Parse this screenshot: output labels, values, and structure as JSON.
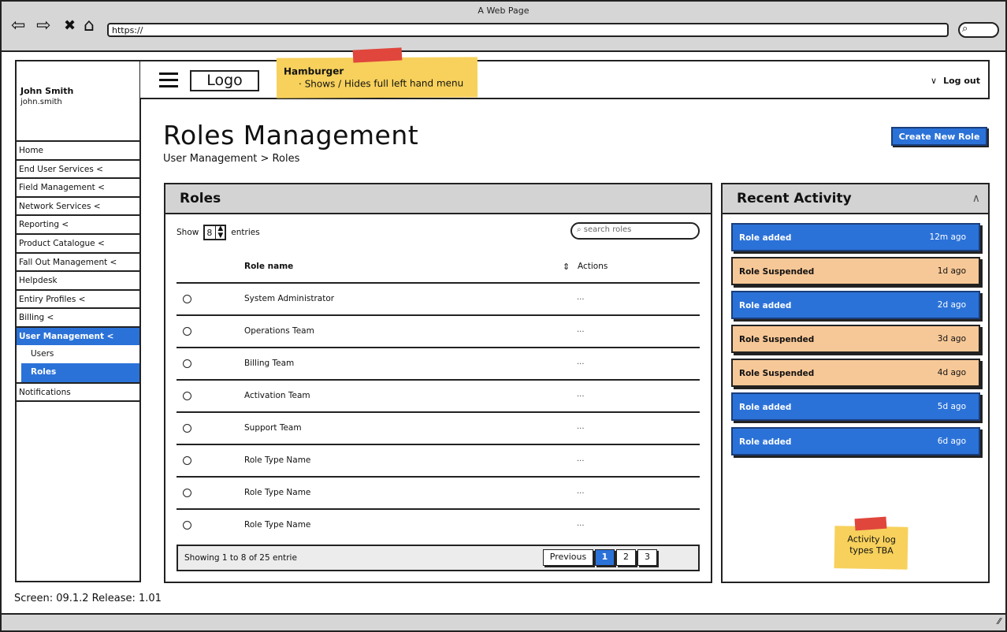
{
  "browser": {
    "window_title": "A Web Page",
    "url": "https://",
    "nav_icons": {
      "back": "⇦",
      "forward": "⇨",
      "close": "✖",
      "home": "⌂"
    },
    "search_icon": "⌕"
  },
  "sidebar": {
    "user_name": "John Smith",
    "user_login": "john.smith",
    "items": [
      {
        "label": "Home"
      },
      {
        "label": "End User Services <"
      },
      {
        "label": "Field Management <"
      },
      {
        "label": "Network Services <"
      },
      {
        "label": "Reporting <"
      },
      {
        "label": "Product Catalogue <"
      },
      {
        "label": "Fall Out Management <"
      },
      {
        "label": "Helpdesk"
      },
      {
        "label": "Entiry Profiles <"
      },
      {
        "label": "Billing <"
      },
      {
        "label": "User Management <"
      }
    ],
    "sub_items": [
      {
        "label": "Users"
      },
      {
        "label": "Roles"
      }
    ],
    "after_items": [
      {
        "label": "Notifications"
      }
    ]
  },
  "header": {
    "logo": "Logo",
    "logout": "Log out",
    "logout_chevron": "∨"
  },
  "notes": {
    "hamburger_title": "Hamburger",
    "hamburger_text": "·   Shows / Hides full left hand menu",
    "activity_note": "Activity log types TBA"
  },
  "page": {
    "title": "Roles Management",
    "breadcrumb": "User Management > Roles",
    "create_button": "Create New Role"
  },
  "roles": {
    "panel_title": "Roles",
    "show_label": "Show",
    "entries_value": "8",
    "entries_label": "entries",
    "search_placeholder": "search roles",
    "col_name": "Role name",
    "col_actions": "Actions",
    "sort_icon": "⇕",
    "rows": [
      {
        "name": "System Administrator",
        "action": "..."
      },
      {
        "name": "Operations Team",
        "action": "..."
      },
      {
        "name": "Billing Team",
        "action": "..."
      },
      {
        "name": "Activation Team",
        "action": "..."
      },
      {
        "name": "Support Team",
        "action": "..."
      },
      {
        "name": "Role Type Name",
        "action": "..."
      },
      {
        "name": "Role Type Name",
        "action": "..."
      },
      {
        "name": "Role Type Name",
        "action": "..."
      }
    ],
    "footer_info": "Showing 1 to 8 of 25 entrie",
    "pager": {
      "previous": "Previous",
      "pages": [
        "1",
        "2",
        "3"
      ],
      "active_page": "1"
    }
  },
  "activity": {
    "panel_title": "Recent Activity",
    "collapse_icon": "∧",
    "items": [
      {
        "label": "Role added",
        "time": "12m ago",
        "color": "#2b72d8"
      },
      {
        "label": "Role Suspended",
        "time": "1d ago",
        "color": "#f7c897"
      },
      {
        "label": "Role added",
        "time": "2d ago",
        "color": "#2b72d8"
      },
      {
        "label": "Role Suspended",
        "time": "3d ago",
        "color": "#f7c897"
      },
      {
        "label": "Role Suspended",
        "time": "4d ago",
        "color": "#f7c897"
      },
      {
        "label": "Role added",
        "time": "5d ago",
        "color": "#2b72d8"
      },
      {
        "label": "Role added",
        "time": "6d ago",
        "color": "#2b72d8"
      }
    ]
  },
  "screen_info": "Screen: 09.1.2  Release: 1.01",
  "colors": {
    "accent": "#2b72d8",
    "suspended": "#f7c897",
    "sticky": "#f7d15c",
    "tape": "#e0463c"
  }
}
